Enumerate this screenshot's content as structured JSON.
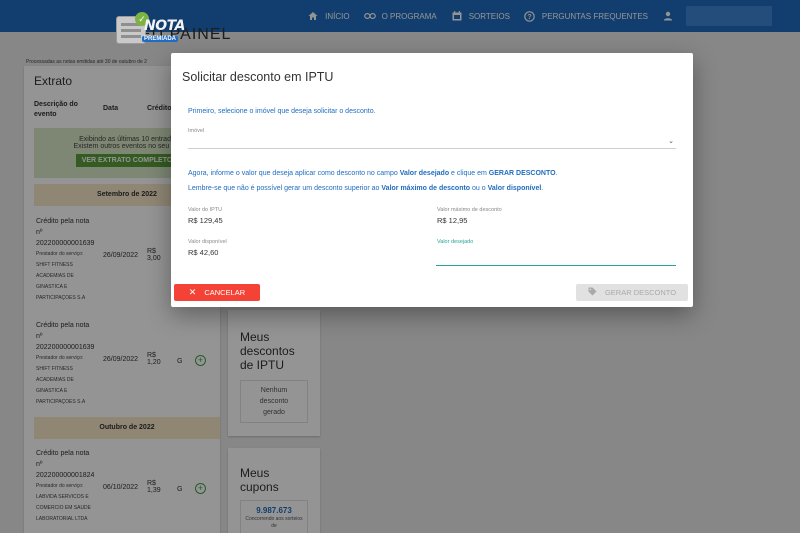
{
  "nav": {
    "items": [
      {
        "label": "Início",
        "icon": "home-icon"
      },
      {
        "label": "O PROGRAMA",
        "icon": "infinity-icon"
      },
      {
        "label": "SORTEIOS",
        "icon": "calendar-icon"
      },
      {
        "label": "PERGUNTAS FREQUENTES",
        "icon": "help-icon"
      }
    ],
    "user_icon": "person-icon"
  },
  "logo": {
    "word": "NOTA",
    "sub": "PREMIADA"
  },
  "page": {
    "title": "EU PAINEL",
    "processed_note": "Processadas as notas emitidas até 30 de outubro de 2",
    "extrato": {
      "title": "Extrato",
      "headers": [
        "Descrição do evento",
        "Data",
        "Crédito"
      ],
      "notice_line1": "Exibindo as últimas 10 entrada",
      "notice_line2": "Existem outros eventos no seu ext",
      "notice_button": "VER EXTRATO COMPLETO",
      "month1": "Setembro de 2022",
      "month2": "Outubro de 2022",
      "entries": [
        {
          "l1": "Crédito pela nota",
          "l2": "nº",
          "l3": "202200000001639",
          "provider_label": "Prestador do serviço:",
          "provider": [
            "SHIFT FITNESS",
            "ACADEMIAS DE",
            "GINASTICA E",
            "PARTICIPAÇOES S.A"
          ],
          "date": "26/09/2022",
          "value": "R$ 3,00",
          "status": ""
        },
        {
          "l1": "Crédito pela nota",
          "l2": "nº",
          "l3": "202200000001639",
          "provider_label": "Prestador do serviço:",
          "provider": [
            "SHIFT FITNESS",
            "ACADEMIAS DE",
            "GINASTICA E",
            "PARTICIPAÇOES S.A"
          ],
          "date": "26/09/2022",
          "value": "R$ 1,20",
          "status": "G"
        },
        {
          "l1": "Crédito pela nota",
          "l2": "nº",
          "l3": "202200000001824",
          "provider_label": "Prestador do serviço:",
          "provider": [
            "LABVIDA SERVICOS E",
            "COMERCIO EM SAUDE",
            "LABORATORIAL LTDA"
          ],
          "date": "06/10/2022",
          "value": "R$ 1,39",
          "status": "G"
        }
      ]
    },
    "iptu_card": {
      "title": "Meus descontos de IPTU",
      "empty": "Nenhum desconto gerado"
    },
    "coupons_card": {
      "title": "Meus cupons",
      "number": "9.987.673",
      "caption": "Concorrendo aos sorteios de"
    }
  },
  "modal": {
    "title": "Solicitar desconto em IPTU",
    "step1": "Primeiro, selecione o imóvel que deseja solicitar o desconto.",
    "imovel_label": "Imóvel",
    "imovel_value": "",
    "step2_a": "Agora, informe o valor que deseja aplicar como desconto no campo ",
    "step2_b": "Valor desejado",
    "step2_c": " e clique em ",
    "step2_d": "GERAR DESCONTO",
    "step2_e": ".",
    "step3_a": "Lembre-se que não é possível gerar um desconto superior ao ",
    "step3_b": "Valor máximo de desconto",
    "step3_c": " ou o ",
    "step3_d": "Valor disponível",
    "step3_e": ".",
    "iptu_label": "Valor do IPTU",
    "iptu_value": "R$ 129,45",
    "max_label": "Valor máximo de desconto",
    "max_value": "R$ 12,95",
    "avail_label": "Valor disponível",
    "avail_value": "R$ 42,60",
    "desired_label": "Valor desejado",
    "desired_value": "",
    "cancel_label": "CANCELAR",
    "generate_label": "GERAR DESCONTO",
    "colors": {
      "accent": "#1f6cc0",
      "cancel": "#f44336",
      "input_focus": "#26a69a",
      "disabled": "#e1e1e1"
    }
  }
}
